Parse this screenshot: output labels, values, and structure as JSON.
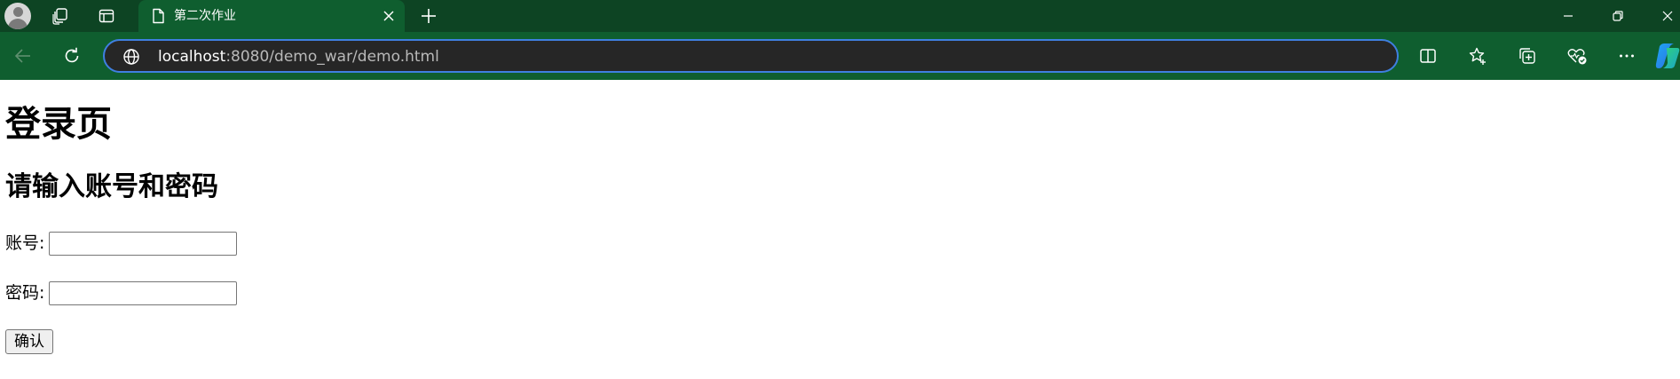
{
  "browser": {
    "tab": {
      "title": "第二次作业"
    },
    "address_bar": {
      "host": "localhost",
      "path": ":8080/demo_war/demo.html"
    },
    "colors": {
      "tabstrip_bg": "#0d4423",
      "toolbar_bg": "#0f5e2f",
      "omnibox_bg": "#262626",
      "omnibox_focus_border": "#3f7fe0"
    },
    "icons": {
      "profile": "avatar",
      "workspaces": "workspaces-icon",
      "tab_actions": "vertical-tabs-icon",
      "tab_favicon": "page-icon",
      "tab_close": "close-icon",
      "new_tab": "plus-icon",
      "minimize": "minimize-icon",
      "restore": "restore-icon",
      "back": "back-arrow-icon",
      "refresh": "refresh-icon",
      "site_info": "globe-icon",
      "split_screen": "split-screen-icon",
      "favorites": "star-add-icon",
      "collections": "collections-icon",
      "browser_essentials": "heart-check-icon",
      "more": "ellipsis-icon",
      "copilot": "copilot-icon"
    }
  },
  "page": {
    "heading": "登录页",
    "subheading": "请输入账号和密码",
    "form": {
      "account_label": "账号:",
      "account_value": "",
      "password_label": "密码:",
      "password_value": "",
      "submit_label": "确认"
    }
  }
}
